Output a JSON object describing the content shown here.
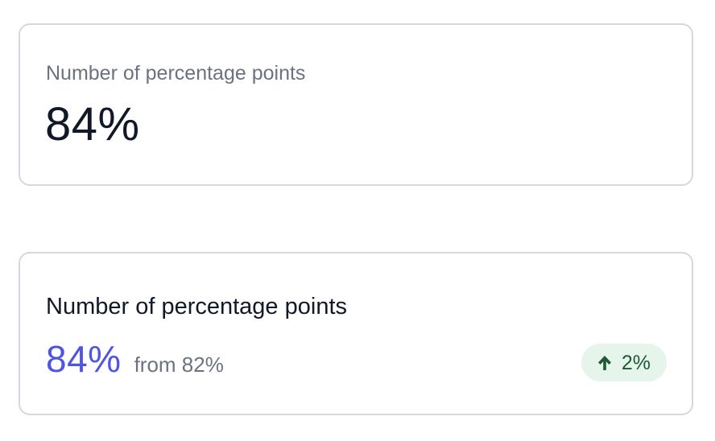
{
  "cards": [
    {
      "label": "Number of percentage points",
      "value": "84%"
    },
    {
      "label": "Number of percentage points",
      "value": "84%",
      "from_text": "from 82%",
      "change": {
        "direction": "up",
        "icon": "arrow-up-icon",
        "text": "2%"
      }
    }
  ],
  "colors": {
    "accent": "#4f55e3",
    "positive_badge_bg": "#e5f5ec",
    "positive_badge_fg": "#1f5a34",
    "muted_text": "#6b7280",
    "primary_text": "#111827",
    "card_border": "#d5d8de"
  }
}
